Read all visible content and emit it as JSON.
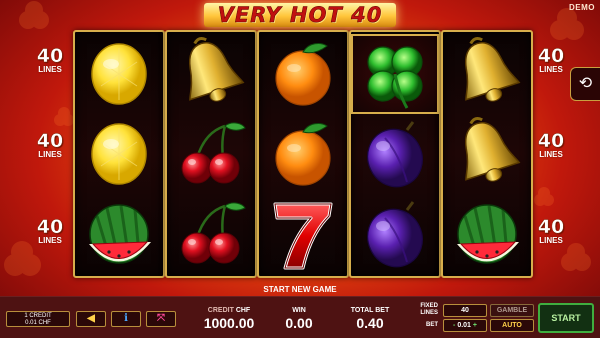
{
  "header": {
    "title": "VERY HOT 40",
    "demo_badge": "DEMO"
  },
  "lines_indicators": {
    "left": [
      {
        "number": "40",
        "label": "LINES"
      },
      {
        "number": "40",
        "label": "LINES"
      },
      {
        "number": "40",
        "label": "LINES"
      }
    ],
    "right": [
      {
        "number": "40",
        "label": "LINES"
      },
      {
        "number": "40",
        "label": "LINES"
      },
      {
        "number": "40",
        "label": "LINES"
      }
    ]
  },
  "side_button": {
    "icon": "history-icon",
    "glyph": "⟲"
  },
  "reels": [
    {
      "symbols": [
        "lemon",
        "lemon",
        "watermelon"
      ]
    },
    {
      "symbols": [
        "bell",
        "cherries",
        "cherries"
      ]
    },
    {
      "symbols": [
        "orange",
        "orange",
        "seven"
      ]
    },
    {
      "symbols": [
        "clover",
        "plum",
        "plum"
      ]
    },
    {
      "symbols": [
        "bell",
        "bell",
        "watermelon"
      ]
    }
  ],
  "highlighted_symbol": {
    "reel": 4,
    "row": 1
  },
  "message": "START NEW GAME",
  "panel": {
    "credit_info": {
      "line1": "1 CREDIT",
      "line2": "0.01 CHF"
    },
    "buttons": [
      {
        "name": "sound",
        "icon": "speaker-icon",
        "glyph": "◀",
        "color": "#ffd24a"
      },
      {
        "name": "info",
        "icon": "info-icon",
        "glyph": "i",
        "color": "#4aa8ff"
      },
      {
        "name": "fullscreen",
        "icon": "fullscreen-icon",
        "glyph": "⤧",
        "color": "#ff4a9a"
      }
    ],
    "credit": {
      "label": "CREDIT",
      "currency": "CHF",
      "value": "1000.00"
    },
    "win": {
      "label": "WIN",
      "value": "0.00"
    },
    "total_bet": {
      "label": "TOTAL BET",
      "value": "0.40"
    },
    "fixed_lines": {
      "label": "FIXED LINES",
      "value": "40"
    },
    "bet": {
      "label": "BET",
      "minus": "-",
      "value": "0.01",
      "plus": "+"
    },
    "gamble_label": "GAMBLE",
    "auto_label": "AUTO",
    "start_label": "START"
  },
  "colors": {
    "frame_gold": "#d7ae4c",
    "panel": "#4e1212",
    "start_green": "#3fae3f",
    "title_red": "#c01010"
  }
}
